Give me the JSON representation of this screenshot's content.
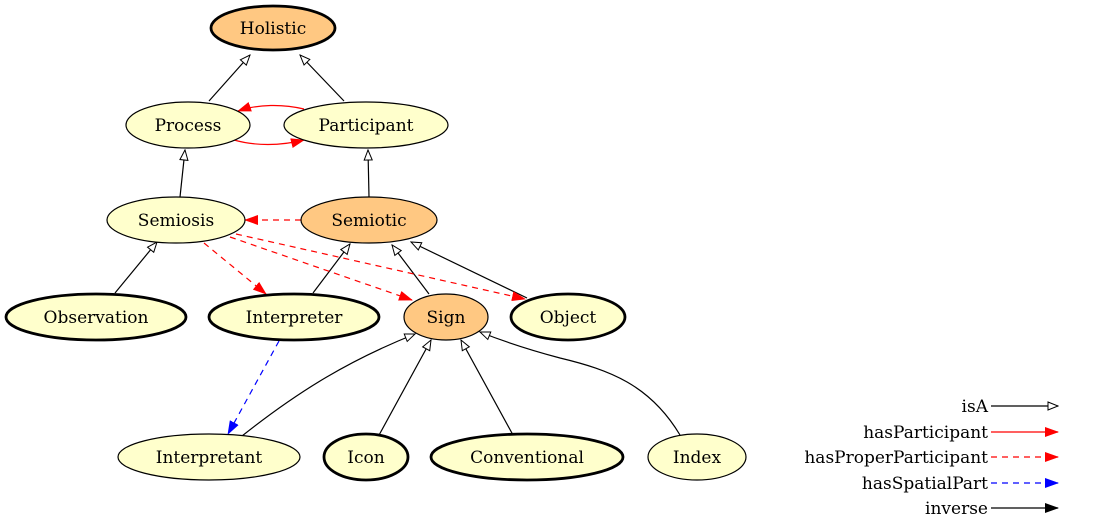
{
  "colors": {
    "class_fill": "#ffffcc",
    "highlight_fill": "#ffc882",
    "isA": "#000000",
    "hasParticipant": "#ff0000",
    "hasProperParticipant": "#ff0000",
    "hasSpatialPart": "#0000ff",
    "inverse": "#000000"
  },
  "nodes": [
    {
      "id": "Holistic",
      "label": "Holistic",
      "style": "highlight",
      "bold": true
    },
    {
      "id": "Process",
      "label": "Process",
      "style": "class",
      "bold": false
    },
    {
      "id": "Participant",
      "label": "Participant",
      "style": "class",
      "bold": false
    },
    {
      "id": "Semiosis",
      "label": "Semiosis",
      "style": "class",
      "bold": false
    },
    {
      "id": "Semiotic",
      "label": "Semiotic",
      "style": "highlight",
      "bold": false
    },
    {
      "id": "Observation",
      "label": "Observation",
      "style": "class",
      "bold": true
    },
    {
      "id": "Interpreter",
      "label": "Interpreter",
      "style": "class",
      "bold": true
    },
    {
      "id": "Sign",
      "label": "Sign",
      "style": "highlight",
      "bold": false
    },
    {
      "id": "Object",
      "label": "Object",
      "style": "class",
      "bold": true
    },
    {
      "id": "Interpretant",
      "label": "Interpretant",
      "style": "class",
      "bold": false
    },
    {
      "id": "Icon",
      "label": "Icon",
      "style": "class",
      "bold": true
    },
    {
      "id": "Conventional",
      "label": "Conventional",
      "style": "class",
      "bold": true
    },
    {
      "id": "Index",
      "label": "Index",
      "style": "class",
      "bold": false
    }
  ],
  "edges": [
    {
      "from": "Process",
      "to": "Holistic",
      "relation": "isA"
    },
    {
      "from": "Participant",
      "to": "Holistic",
      "relation": "isA"
    },
    {
      "from": "Process",
      "to": "Participant",
      "relation": "hasParticipant"
    },
    {
      "from": "Participant",
      "to": "Process",
      "relation": "inverse-hasParticipant"
    },
    {
      "from": "Semiosis",
      "to": "Process",
      "relation": "isA"
    },
    {
      "from": "Semiotic",
      "to": "Participant",
      "relation": "isA"
    },
    {
      "from": "Semiotic",
      "to": "Semiosis",
      "relation": "inverse-hasProperParticipant"
    },
    {
      "from": "Observation",
      "to": "Semiosis",
      "relation": "isA"
    },
    {
      "from": "Interpreter",
      "to": "Semiotic",
      "relation": "isA"
    },
    {
      "from": "Sign",
      "to": "Semiotic",
      "relation": "isA"
    },
    {
      "from": "Object",
      "to": "Semiotic",
      "relation": "isA"
    },
    {
      "from": "Semiosis",
      "to": "Interpreter",
      "relation": "hasProperParticipant"
    },
    {
      "from": "Semiosis",
      "to": "Sign",
      "relation": "hasProperParticipant"
    },
    {
      "from": "Semiosis",
      "to": "Object",
      "relation": "hasProperParticipant"
    },
    {
      "from": "Interpreter",
      "to": "Interpretant",
      "relation": "hasSpatialPart"
    },
    {
      "from": "Interpretant",
      "to": "Sign",
      "relation": "isA"
    },
    {
      "from": "Icon",
      "to": "Sign",
      "relation": "isA"
    },
    {
      "from": "Conventional",
      "to": "Sign",
      "relation": "isA"
    },
    {
      "from": "Index",
      "to": "Sign",
      "relation": "isA"
    }
  ],
  "legend": [
    {
      "label": "isA",
      "relation": "isA"
    },
    {
      "label": "hasParticipant",
      "relation": "hasParticipant"
    },
    {
      "label": "hasProperParticipant",
      "relation": "hasProperParticipant"
    },
    {
      "label": "hasSpatialPart",
      "relation": "hasSpatialPart"
    },
    {
      "label": "inverse",
      "relation": "inverse"
    }
  ]
}
